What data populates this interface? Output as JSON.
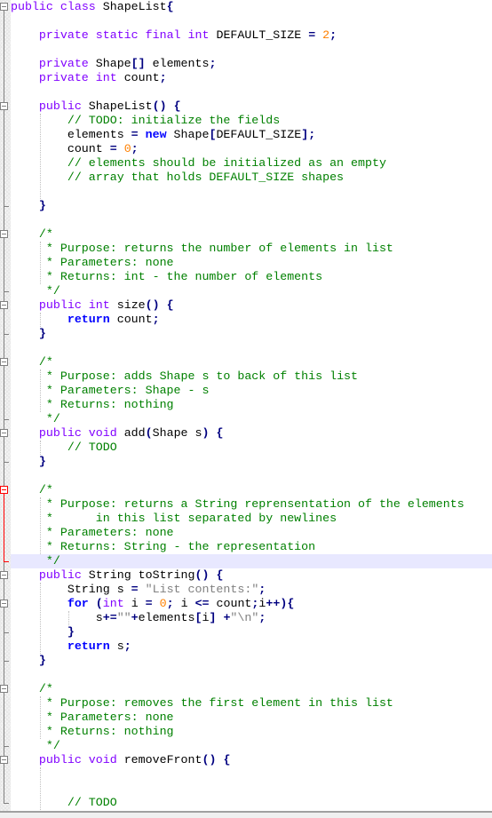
{
  "editor": {
    "language": "java",
    "current_line_index": 39,
    "lines": [
      [
        [
          "kw",
          "public"
        ],
        [
          "plain",
          " "
        ],
        [
          "kw",
          "class"
        ],
        [
          "plain",
          " ShapeList"
        ],
        [
          "brace",
          "{"
        ]
      ],
      [],
      [
        [
          "plain",
          "    "
        ],
        [
          "kw",
          "private"
        ],
        [
          "plain",
          " "
        ],
        [
          "kw",
          "static"
        ],
        [
          "plain",
          " "
        ],
        [
          "kw",
          "final"
        ],
        [
          "plain",
          " "
        ],
        [
          "kw",
          "int"
        ],
        [
          "plain",
          " DEFAULT_SIZE "
        ],
        [
          "op",
          "="
        ],
        [
          "plain",
          " "
        ],
        [
          "num",
          "2"
        ],
        [
          "op",
          ";"
        ]
      ],
      [],
      [
        [
          "plain",
          "    "
        ],
        [
          "kw",
          "private"
        ],
        [
          "plain",
          " Shape"
        ],
        [
          "op",
          "[]"
        ],
        [
          "plain",
          " elements"
        ],
        [
          "op",
          ";"
        ]
      ],
      [
        [
          "plain",
          "    "
        ],
        [
          "kw",
          "private"
        ],
        [
          "plain",
          " "
        ],
        [
          "kw",
          "int"
        ],
        [
          "plain",
          " count"
        ],
        [
          "op",
          ";"
        ]
      ],
      [],
      [
        [
          "plain",
          "    "
        ],
        [
          "kw",
          "public"
        ],
        [
          "plain",
          " ShapeList"
        ],
        [
          "op",
          "()"
        ],
        [
          "plain",
          " "
        ],
        [
          "brace",
          "{"
        ]
      ],
      [
        [
          "plain",
          "        "
        ],
        [
          "cm",
          "// TODO: initialize the fields"
        ]
      ],
      [
        [
          "plain",
          "        elements "
        ],
        [
          "op",
          "="
        ],
        [
          "plain",
          " "
        ],
        [
          "kw2",
          "new"
        ],
        [
          "plain",
          " Shape"
        ],
        [
          "op",
          "["
        ],
        [
          "plain",
          "DEFAULT_SIZE"
        ],
        [
          "op",
          "];"
        ]
      ],
      [
        [
          "plain",
          "        count "
        ],
        [
          "op",
          "="
        ],
        [
          "plain",
          " "
        ],
        [
          "num",
          "0"
        ],
        [
          "op",
          ";"
        ]
      ],
      [
        [
          "plain",
          "        "
        ],
        [
          "cm",
          "// elements should be initialized as an empty"
        ]
      ],
      [
        [
          "plain",
          "        "
        ],
        [
          "cm",
          "// array that holds DEFAULT_SIZE shapes"
        ]
      ],
      [],
      [
        [
          "plain",
          "    "
        ],
        [
          "brace",
          "}"
        ]
      ],
      [],
      [
        [
          "plain",
          "    "
        ],
        [
          "cm",
          "/*"
        ]
      ],
      [
        [
          "plain",
          "     "
        ],
        [
          "cm",
          "* Purpose: returns the number of elements in list"
        ]
      ],
      [
        [
          "plain",
          "     "
        ],
        [
          "cm",
          "* Parameters: none"
        ]
      ],
      [
        [
          "plain",
          "     "
        ],
        [
          "cm",
          "* Returns: int - the number of elements"
        ]
      ],
      [
        [
          "plain",
          "     "
        ],
        [
          "cm",
          "*/"
        ]
      ],
      [
        [
          "plain",
          "    "
        ],
        [
          "kw",
          "public"
        ],
        [
          "plain",
          " "
        ],
        [
          "kw",
          "int"
        ],
        [
          "plain",
          " size"
        ],
        [
          "op",
          "()"
        ],
        [
          "plain",
          " "
        ],
        [
          "brace",
          "{"
        ]
      ],
      [
        [
          "plain",
          "        "
        ],
        [
          "kw2",
          "return"
        ],
        [
          "plain",
          " count"
        ],
        [
          "op",
          ";"
        ]
      ],
      [
        [
          "plain",
          "    "
        ],
        [
          "brace",
          "}"
        ]
      ],
      [],
      [
        [
          "plain",
          "    "
        ],
        [
          "cm",
          "/*"
        ]
      ],
      [
        [
          "plain",
          "     "
        ],
        [
          "cm",
          "* Purpose: adds Shape s to back of this list"
        ]
      ],
      [
        [
          "plain",
          "     "
        ],
        [
          "cm",
          "* Parameters: Shape - s"
        ]
      ],
      [
        [
          "plain",
          "     "
        ],
        [
          "cm",
          "* Returns: nothing"
        ]
      ],
      [
        [
          "plain",
          "     "
        ],
        [
          "cm",
          "*/"
        ]
      ],
      [
        [
          "plain",
          "    "
        ],
        [
          "kw",
          "public"
        ],
        [
          "plain",
          " "
        ],
        [
          "kw",
          "void"
        ],
        [
          "plain",
          " add"
        ],
        [
          "op",
          "("
        ],
        [
          "plain",
          "Shape s"
        ],
        [
          "op",
          ")"
        ],
        [
          "plain",
          " "
        ],
        [
          "brace",
          "{"
        ]
      ],
      [
        [
          "plain",
          "        "
        ],
        [
          "cm",
          "// TODO"
        ]
      ],
      [
        [
          "plain",
          "    "
        ],
        [
          "brace",
          "}"
        ]
      ],
      [],
      [
        [
          "plain",
          "    "
        ],
        [
          "cm",
          "/*"
        ]
      ],
      [
        [
          "plain",
          "     "
        ],
        [
          "cm",
          "* Purpose: returns a String reprensentation of the elements"
        ]
      ],
      [
        [
          "plain",
          "     "
        ],
        [
          "cm",
          "*      in this list separated by newlines"
        ]
      ],
      [
        [
          "plain",
          "     "
        ],
        [
          "cm",
          "* Parameters: none"
        ]
      ],
      [
        [
          "plain",
          "     "
        ],
        [
          "cm",
          "* Returns: String - the representation"
        ]
      ],
      [
        [
          "plain",
          "     "
        ],
        [
          "cm",
          "*/"
        ]
      ],
      [
        [
          "plain",
          "    "
        ],
        [
          "kw",
          "public"
        ],
        [
          "plain",
          " String toString"
        ],
        [
          "op",
          "()"
        ],
        [
          "plain",
          " "
        ],
        [
          "brace",
          "{"
        ]
      ],
      [
        [
          "plain",
          "        String s "
        ],
        [
          "op",
          "="
        ],
        [
          "plain",
          " "
        ],
        [
          "str",
          "\"List contents:\""
        ],
        [
          "op",
          ";"
        ]
      ],
      [
        [
          "plain",
          "        "
        ],
        [
          "kw2",
          "for"
        ],
        [
          "plain",
          " "
        ],
        [
          "op",
          "("
        ],
        [
          "kw",
          "int"
        ],
        [
          "plain",
          " i "
        ],
        [
          "op",
          "="
        ],
        [
          "plain",
          " "
        ],
        [
          "num",
          "0"
        ],
        [
          "op",
          ";"
        ],
        [
          "plain",
          " i "
        ],
        [
          "op",
          "<="
        ],
        [
          "plain",
          " count"
        ],
        [
          "op",
          ";"
        ],
        [
          "plain",
          "i"
        ],
        [
          "op",
          "++){"
        ]
      ],
      [
        [
          "plain",
          "            s"
        ],
        [
          "op",
          "+="
        ],
        [
          "str",
          "\"\""
        ],
        [
          "op",
          "+"
        ],
        [
          "plain",
          "elements"
        ],
        [
          "op",
          "["
        ],
        [
          "plain",
          "i"
        ],
        [
          "op",
          "]"
        ],
        [
          "plain",
          " "
        ],
        [
          "op",
          "+"
        ],
        [
          "str",
          "\"\\n\""
        ],
        [
          "op",
          ";"
        ]
      ],
      [
        [
          "plain",
          "        "
        ],
        [
          "brace",
          "}"
        ]
      ],
      [
        [
          "plain",
          "        "
        ],
        [
          "kw2",
          "return"
        ],
        [
          "plain",
          " s"
        ],
        [
          "op",
          ";"
        ]
      ],
      [
        [
          "plain",
          "    "
        ],
        [
          "brace",
          "}"
        ]
      ],
      [],
      [
        [
          "plain",
          "    "
        ],
        [
          "cm",
          "/*"
        ]
      ],
      [
        [
          "plain",
          "     "
        ],
        [
          "cm",
          "* Purpose: removes the first element in this list"
        ]
      ],
      [
        [
          "plain",
          "     "
        ],
        [
          "cm",
          "* Parameters: none"
        ]
      ],
      [
        [
          "plain",
          "     "
        ],
        [
          "cm",
          "* Returns: nothing"
        ]
      ],
      [
        [
          "plain",
          "     "
        ],
        [
          "cm",
          "*/"
        ]
      ],
      [
        [
          "plain",
          "    "
        ],
        [
          "kw",
          "public"
        ],
        [
          "plain",
          " "
        ],
        [
          "kw",
          "void"
        ],
        [
          "plain",
          " removeFront"
        ],
        [
          "op",
          "()"
        ],
        [
          "plain",
          " "
        ],
        [
          "brace",
          "{"
        ]
      ],
      [],
      [],
      [
        [
          "plain",
          "        "
        ],
        [
          "cm",
          "// TODO"
        ]
      ]
    ],
    "folds": [
      {
        "start": 0,
        "end": 56,
        "highlight": false
      },
      {
        "start": 7,
        "end": 14,
        "highlight": false
      },
      {
        "start": 16,
        "end": 20,
        "highlight": false
      },
      {
        "start": 21,
        "end": 23,
        "highlight": false
      },
      {
        "start": 25,
        "end": 29,
        "highlight": false
      },
      {
        "start": 30,
        "end": 32,
        "highlight": false
      },
      {
        "start": 34,
        "end": 39,
        "highlight": true
      },
      {
        "start": 40,
        "end": 46,
        "highlight": false
      },
      {
        "start": 42,
        "end": 44,
        "highlight": false
      },
      {
        "start": 48,
        "end": 52,
        "highlight": false
      },
      {
        "start": 53,
        "end": 56,
        "highlight": false
      }
    ],
    "colors": {
      "keyword": "#8000ff",
      "keyword_bold": "#0000ff",
      "comment": "#008000",
      "number": "#ff8000",
      "string": "#808080",
      "operator": "#000080",
      "current_line": "#e8e8ff",
      "fold_active": "#ff0000"
    }
  }
}
